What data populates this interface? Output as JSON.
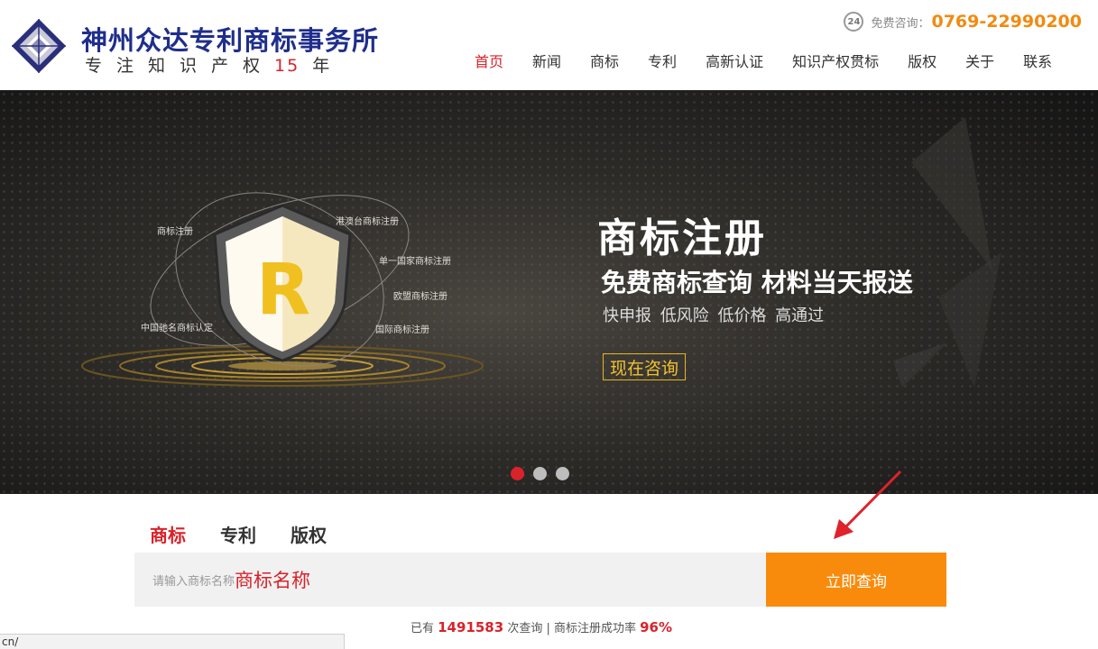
{
  "brand": {
    "title": "神州众达专利商标事务所",
    "slogan_text": "专注知识产权",
    "slogan_years": "15",
    "slogan_unit": "年"
  },
  "hotline": {
    "icon": "24h-service-icon",
    "icon_text": "24",
    "label": "免费咨询：",
    "phone": "0769-22990200"
  },
  "nav": {
    "items": [
      "首页",
      "新闻",
      "商标",
      "专利",
      "高新认证",
      "知识产权贯标",
      "版权",
      "关于",
      "联系"
    ],
    "active_index": 0
  },
  "banner": {
    "title": "商标注册",
    "subtitle": "免费商标查询 材料当天报送",
    "features": "快申报 低风险 低价格 高通过",
    "cta": "现在咨询",
    "orbit_labels": [
      "商标注册",
      "港澳台商标注册",
      "单一国家商标注册",
      "欧盟商标注册",
      "国际商标注册",
      "中国驰名商标认定"
    ],
    "shield_letter": "R",
    "slides": 3,
    "active_slide": 0
  },
  "search": {
    "tabs": [
      "商标",
      "专利",
      "版权"
    ],
    "active_tab": 0,
    "placeholder": "请输入商标名称",
    "typed_value": "商标名称",
    "button": "立即查询"
  },
  "stats": {
    "prefix": "已有",
    "count": "1491583",
    "middle": "次查询 | 商标注册成功率",
    "rate": "96%"
  },
  "statusbar": {
    "url": "cn/"
  },
  "colors": {
    "brand_blue": "#1f2e8c",
    "accent_red": "#d9222a",
    "accent_orange": "#f98b0c",
    "gold": "#e3b520"
  }
}
